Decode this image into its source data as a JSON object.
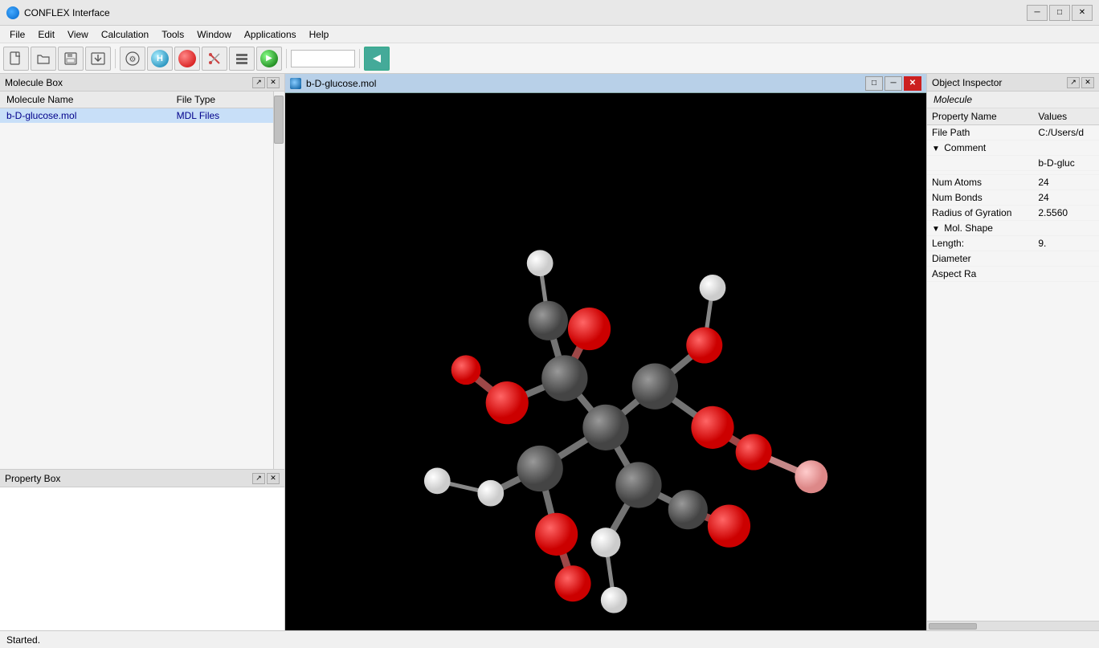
{
  "titleBar": {
    "icon": "conflex-icon",
    "title": "CONFLEX Interface",
    "controls": [
      "minimize",
      "maximize",
      "close"
    ]
  },
  "menuBar": {
    "items": [
      "File",
      "Edit",
      "View",
      "Calculation",
      "Tools",
      "Window",
      "Applications",
      "Help"
    ]
  },
  "toolbar": {
    "buttons": [
      {
        "name": "new",
        "icon": "📄"
      },
      {
        "name": "open",
        "icon": "📂"
      },
      {
        "name": "save",
        "icon": "💾"
      },
      {
        "name": "import",
        "icon": "📥"
      },
      {
        "name": "fragment",
        "icon": "⚙"
      },
      {
        "name": "hydrogen",
        "label": "H",
        "circle": true,
        "color": "h"
      },
      {
        "name": "stop",
        "circle": true,
        "color": "red"
      },
      {
        "name": "scissors",
        "icon": "✂"
      },
      {
        "name": "stack",
        "icon": "≡"
      },
      {
        "name": "run",
        "circle": true,
        "color": "green"
      }
    ],
    "input_placeholder": ""
  },
  "moleculeBox": {
    "title": "Molecule Box",
    "columns": [
      "Molecule Name",
      "File Type"
    ],
    "rows": [
      {
        "name": "b-D-glucose.mol",
        "type": "MDL Files"
      }
    ]
  },
  "propertyBox": {
    "title": "Property Box"
  },
  "viewer": {
    "title": "b-D-glucose.mol",
    "icon": "molecule-icon"
  },
  "objectInspector": {
    "title": "Object Inspector",
    "section": "Molecule",
    "columns": [
      "Property Name",
      "Values"
    ],
    "rows": [
      {
        "name": "File Path",
        "value": "C:/Users/d",
        "indent": false
      },
      {
        "name": "Comment",
        "value": "",
        "indent": false,
        "collapsible": true,
        "expanded": true
      },
      {
        "name": "",
        "value": "b-D-gluc",
        "indent": true
      },
      {
        "name": "",
        "value": "",
        "indent": true
      },
      {
        "name": "Num Atoms",
        "value": "24",
        "indent": false
      },
      {
        "name": "Num Bonds",
        "value": "24",
        "indent": false
      },
      {
        "name": "Radius of Gyration",
        "value": "2.5560",
        "indent": false
      },
      {
        "name": "Mol. Shape",
        "value": "",
        "indent": false,
        "collapsible": true,
        "expanded": true
      },
      {
        "name": "Length:",
        "value": "9.",
        "indent": true
      },
      {
        "name": "Diameter",
        "value": "",
        "indent": true
      },
      {
        "name": "Aspect Ra",
        "value": "",
        "indent": true
      }
    ]
  },
  "statusBar": {
    "text": "Started."
  }
}
